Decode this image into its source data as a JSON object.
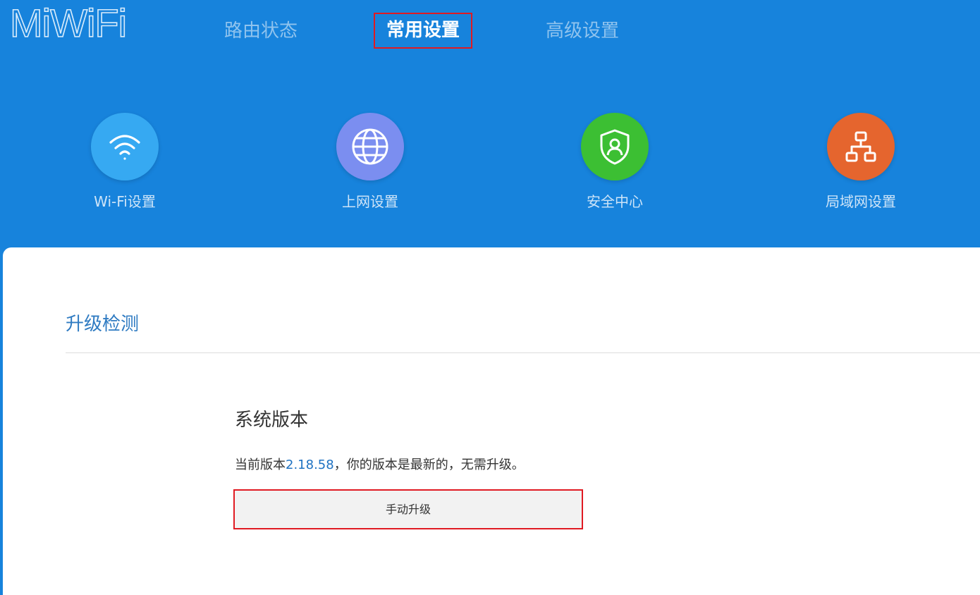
{
  "brand": {
    "logo_text": "MiWiFi"
  },
  "nav": {
    "items": [
      {
        "label": "路由状态"
      },
      {
        "label": "常用设置",
        "active": true
      },
      {
        "label": "高级设置"
      }
    ]
  },
  "quick_settings": [
    {
      "label": "Wi-Fi设置",
      "icon": "wifi-icon",
      "color": "#36a9f2"
    },
    {
      "label": "上网设置",
      "icon": "globe-icon",
      "color": "#7b8ef0"
    },
    {
      "label": "安全中心",
      "icon": "shield-user-icon",
      "color": "#3cbf33"
    },
    {
      "label": "局域网设置",
      "icon": "network-icon",
      "color": "#e5652e"
    }
  ],
  "content": {
    "section_title": "升级检测",
    "sub_title": "系统版本",
    "version_prefix": "当前版本",
    "version": "2.18.58",
    "version_suffix": "，你的版本是最新的，无需升级。",
    "upgrade_button": "手动升级"
  },
  "colors": {
    "header_bg": "#1783dc",
    "highlight_border": "#e01a22",
    "link_blue": "#1f72c2"
  }
}
